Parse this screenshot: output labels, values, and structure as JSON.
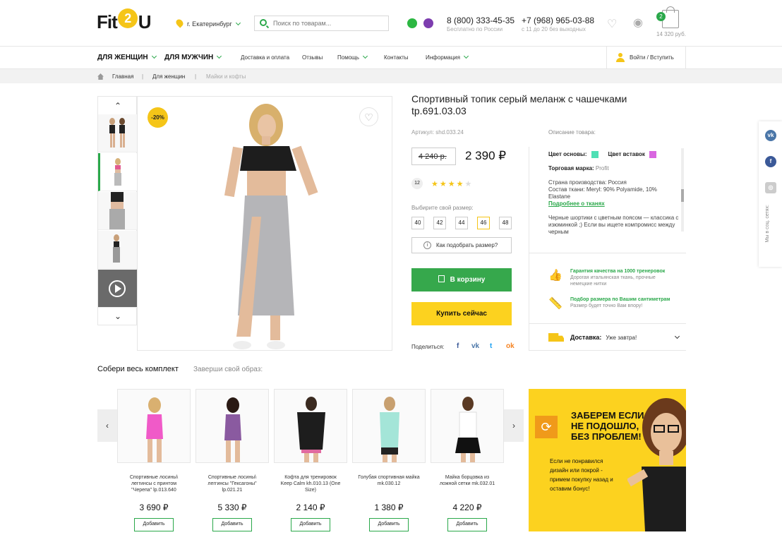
{
  "header": {
    "logo_left": "Fit",
    "logo_mid": "2",
    "logo_right": "U",
    "city": "г. Екатеринбург",
    "search_placeholder": "Поиск по товарам...",
    "phone1": "8 (800) 333-45-35",
    "phone1_note": "Бесплатно по России",
    "phone2": "+7 (968) 965-03-88",
    "phone2_note": "с 11 до 20 без выходных",
    "cart_count": "2",
    "cart_sum": "14 320 руб."
  },
  "nav": {
    "women": "ДЛЯ ЖЕНЩИН",
    "men": "ДЛЯ МУЖЧИН",
    "delivery": "Доставка и оплата",
    "reviews": "Отзывы",
    "help": "Помощь",
    "contacts": "Контакты",
    "info": "Информация",
    "login": "Войти / Вступить"
  },
  "breadcrumb": {
    "home": "Главная",
    "sep": "|",
    "women": "Для женщин",
    "current": "Майки и кофты"
  },
  "product": {
    "discount": "-20%",
    "title": "Спортивный топик серый меланж с чашечками tp.691.03.03",
    "sku": "Артикул: shd.033.24",
    "old_price": "4 240 р.",
    "new_price": "2 390 ₽",
    "review_count": "12",
    "rating": 4,
    "rating_max": 5,
    "size_label": "Выбирите свой размер:",
    "sizes": [
      "40",
      "42",
      "44",
      "46",
      "48"
    ],
    "selected_size": "46",
    "how_size": "Как подобрать размер?",
    "cart_button": "В корзину",
    "buy_button": "Купить сейчас",
    "share_label": "Поделиться:"
  },
  "description": {
    "label": "Описание товара:",
    "base_color_label": "Цвет основы:",
    "base_color": "#4fe0b5",
    "insert_color_label": "Цвет вставок",
    "insert_color": "#d966e0",
    "brand_label": "Торговая марка:",
    "brand": "Profit",
    "country": "Страна производства: Россия",
    "fabric": "Состав ткани: Meryl: 90% Polyamide, 10% Elastane",
    "fabric_link": "Подробнее о тканях",
    "text": "Черные шортики с цветным поясом — классика с изюминкой ;) Если вы ищете компромисс между черным"
  },
  "guarantees": [
    {
      "title": "Гарантия качества на 1000 тренеровок",
      "text": "Дорогая итальянская ткань, прочные немецкие нитки"
    },
    {
      "title": "Подбор размера по Вашим сантиметрам",
      "text": "Размер будет точно Вам впору!"
    }
  ],
  "delivery": {
    "label": "Доставка:",
    "value": "Уже завтра!"
  },
  "social_sidebar": {
    "label": "Мы в соц. сетях:"
  },
  "set": {
    "title": "Собери весь комплект",
    "subtitle": "Заверши свой образ:",
    "add_label": "Добавить",
    "items": [
      {
        "name": "Спортивные лосины\\ леггинсы с принтом \"Черепа\" lp.013.640",
        "price": "3 690 ₽"
      },
      {
        "name": "Спортивные лосины\\ леггинсы \"Гексагоны\" lp.021.21",
        "price": "5 330 ₽"
      },
      {
        "name": "Кофта для тренировок Keep Calm kh.010.13 (One Size)",
        "price": "2 140 ₽"
      },
      {
        "name": "Голубая спортивная майка mk.030.12",
        "price": "1 380 ₽"
      },
      {
        "name": "Майка борцовка из ложной сетки mk.032.01",
        "price": "4 220 ₽"
      }
    ]
  },
  "promo": {
    "headline": "ЗАБЕРЕМ ЕСЛИ НЕ ПОДОШЛО, БЕЗ ПРОБЛЕМ!",
    "text": "Если не понравился дизайн или покрой - примем покупку назад и оставим бонус!"
  },
  "colors": {
    "accent": "#2aa84a",
    "yellow": "#fcd21f"
  }
}
